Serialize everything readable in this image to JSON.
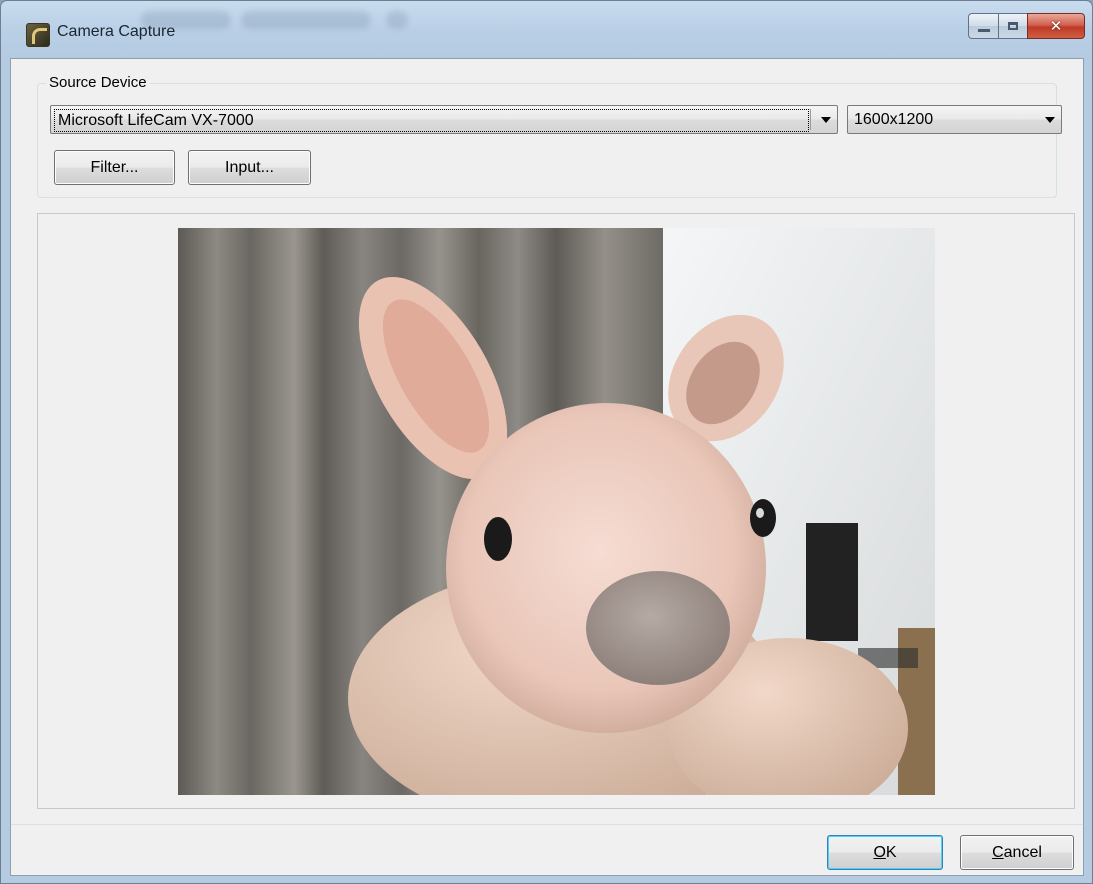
{
  "window": {
    "title": "Camera Capture"
  },
  "source_device": {
    "group_label": "Source Device",
    "device_select_value": "Microsoft LifeCam VX-7000",
    "resolution_select_value": "1600x1200",
    "filter_button_label": "Filter...",
    "input_button_label": "Input..."
  },
  "footer": {
    "ok_mnemonic": "O",
    "ok_rest": "K",
    "cancel_mnemonic": "C",
    "cancel_rest": "ancel"
  },
  "colors": {
    "titlebar": "#b9cfe5",
    "client_background": "#f0f0f0",
    "close_button": "#c7432b",
    "default_button_border": "#3c7fb1"
  },
  "icons": {
    "app": "camera-app-icon",
    "minimize": "minimize-icon",
    "maximize": "maximize-icon",
    "close": "close-icon",
    "dropdown": "chevron-down-icon"
  }
}
